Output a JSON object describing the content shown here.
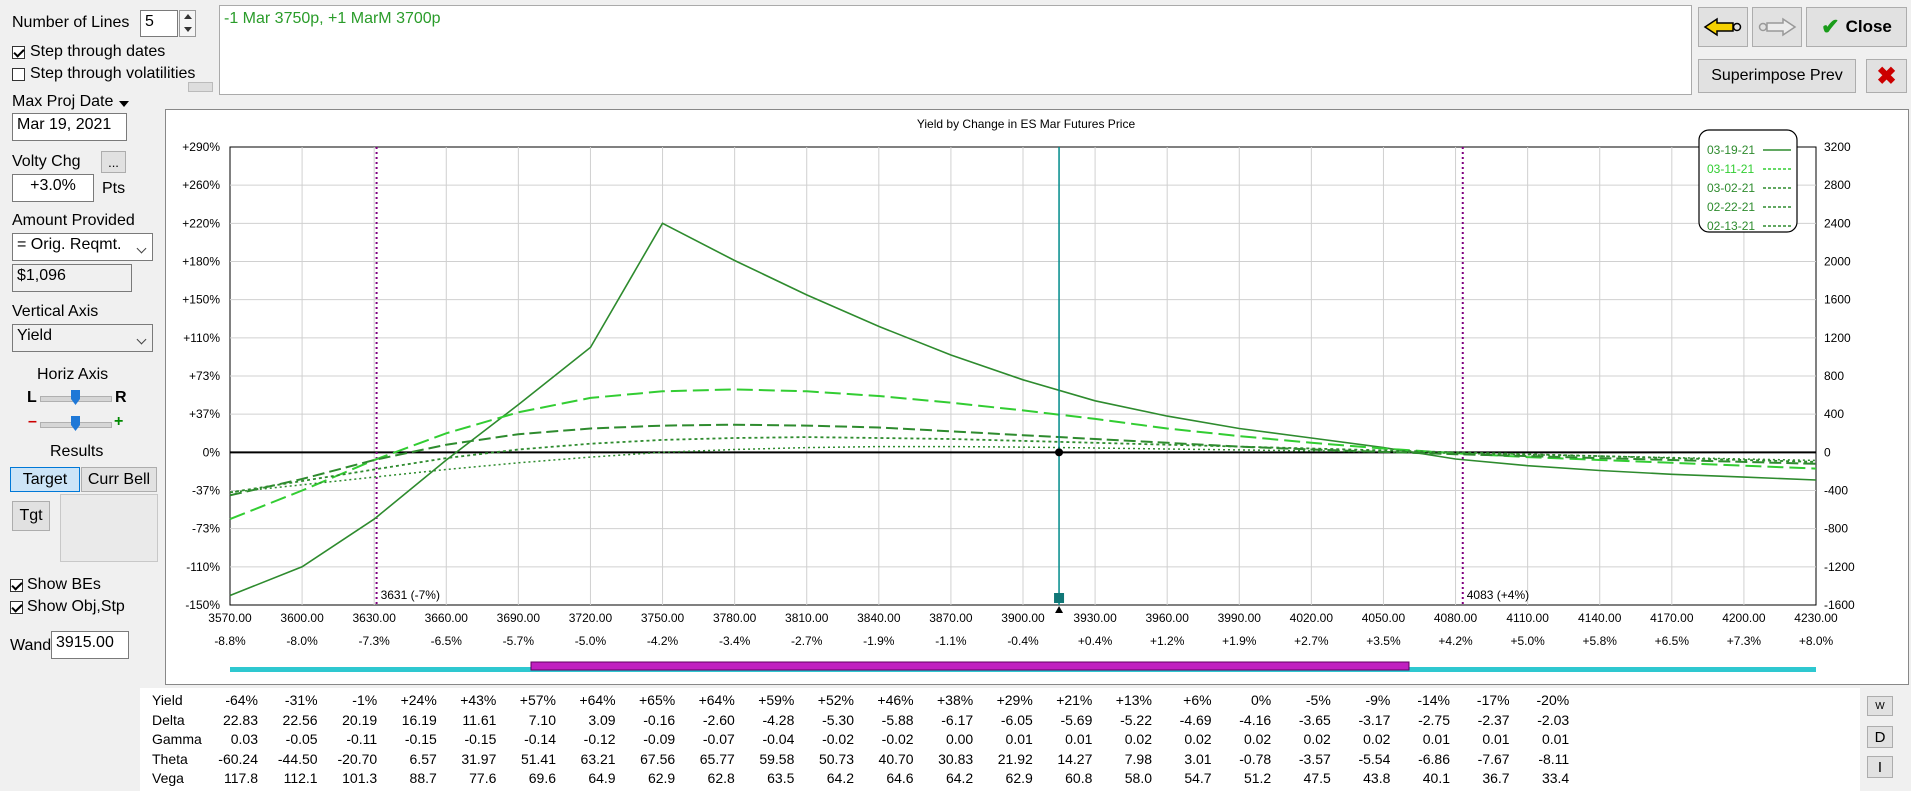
{
  "controls": {
    "num_lines_label": "Number of Lines",
    "num_lines_value": "5",
    "step_dates_label": "Step through dates",
    "step_dates_checked": true,
    "step_vols_label": "Step through volatilities",
    "step_vols_checked": false,
    "max_proj_label": "Max Proj Date",
    "max_proj_value": "Mar 19, 2021",
    "volty_label": "Volty Chg",
    "volty_btn": "...",
    "volty_value": "+3.0%",
    "volty_unit": "Pts",
    "amount_label": "Amount Provided",
    "amount_select": "= Orig. Reqmt.",
    "amount_value": "$1,096",
    "vaxis_label": "Vertical Axis",
    "vaxis_select": "Yield",
    "horiz_label": "Horiz Axis",
    "horiz_l": "L",
    "horiz_r": "R",
    "zoom_minus": "–",
    "zoom_plus": "+",
    "results_label": "Results",
    "target_btn": "Target",
    "currbell_btn": "Curr Bell",
    "tgt_btn": "Tgt",
    "show_bes_label": "Show BEs",
    "show_bes_checked": true,
    "show_obj_label": "Show Obj,Stp",
    "show_obj_checked": true,
    "wand_label": "Wand",
    "wand_value": "3915.00"
  },
  "position_text": "-1 Mar 3750p, +1 MarM 3700p",
  "buttons": {
    "close": "Close",
    "superimpose": "Superimpose Prev"
  },
  "colors": {
    "line_primary": "#2e8b2e",
    "line_light": "#32cd32",
    "be_line": "#800080",
    "wand_line": "#008b8b"
  },
  "chart_data": {
    "type": "line",
    "title": "Yield by Change in ES Mar Futures Price",
    "x_ticks": [
      "3570.00",
      "3600.00",
      "3630.00",
      "3660.00",
      "3690.00",
      "3720.00",
      "3750.00",
      "3780.00",
      "3810.00",
      "3840.00",
      "3870.00",
      "3900.00",
      "3930.00",
      "3960.00",
      "3990.00",
      "4020.00",
      "4050.00",
      "4080.00",
      "4110.00",
      "4140.00",
      "4170.00",
      "4200.00",
      "4230.00"
    ],
    "x_pct_ticks": [
      "-8.8%",
      "-8.0%",
      "-7.3%",
      "-6.5%",
      "-5.7%",
      "-5.0%",
      "-4.2%",
      "-3.4%",
      "-2.7%",
      "-1.9%",
      "-1.1%",
      "-0.4%",
      "+0.4%",
      "+1.2%",
      "+1.9%",
      "+2.7%",
      "+3.5%",
      "+4.2%",
      "+5.0%",
      "+5.8%",
      "+6.5%",
      "+7.3%",
      "+8.0%"
    ],
    "left_ticks": [
      "+290%",
      "+260%",
      "+220%",
      "+180%",
      "+150%",
      "+110%",
      "+73%",
      "+37%",
      "0%",
      "-37%",
      "-73%",
      "-110%",
      "-150%"
    ],
    "right_ticks": [
      "3200",
      "2800",
      "2400",
      "2000",
      "1600",
      "1200",
      "800",
      "400",
      "0",
      "-400",
      "-800",
      "-1200",
      "-1600"
    ],
    "xlim": [
      3570,
      4230
    ],
    "ylim": [
      -1600,
      3200
    ],
    "legend": [
      "03-19-21",
      "03-11-21",
      "03-02-21",
      "02-22-21",
      "02-13-21"
    ],
    "legend_position": "top-right",
    "breakevens": [
      {
        "x": 3631,
        "label": "3631 (-7%)"
      },
      {
        "x": 4083,
        "label": "4083 (+4%)"
      }
    ],
    "wand_x": 3915,
    "series": [
      {
        "name": "03-19-21",
        "style": "solid",
        "x": [
          3570,
          3600,
          3630,
          3660,
          3690,
          3720,
          3750,
          3780,
          3810,
          3840,
          3870,
          3900,
          3930,
          3960,
          3990,
          4020,
          4050,
          4080,
          4110,
          4140,
          4170,
          4200,
          4230
        ],
        "y": [
          -1500,
          -1200,
          -700,
          -80,
          500,
          1100,
          2400,
          2010,
          1650,
          1320,
          1020,
          760,
          540,
          380,
          250,
          150,
          50,
          -70,
          -140,
          -190,
          -230,
          -260,
          -290
        ]
      },
      {
        "name": "03-11-21",
        "style": "long-dash",
        "x": [
          3570,
          3600,
          3630,
          3660,
          3690,
          3720,
          3750,
          3780,
          3810,
          3840,
          3870,
          3900,
          3930,
          3960,
          3990,
          4020,
          4050,
          4080,
          4110,
          4140,
          4170,
          4200,
          4230
        ],
        "y": [
          -700,
          -400,
          -80,
          200,
          420,
          570,
          640,
          660,
          640,
          590,
          520,
          440,
          350,
          250,
          170,
          100,
          40,
          -10,
          -50,
          -80,
          -110,
          -140,
          -170
        ]
      },
      {
        "name": "03-02-21",
        "style": "dash",
        "x": [
          3570,
          3600,
          3630,
          3660,
          3690,
          3720,
          3750,
          3780,
          3810,
          3840,
          3870,
          3900,
          3930,
          3960,
          3990,
          4020,
          4050,
          4080,
          4110,
          4140,
          4170,
          4200,
          4230
        ],
        "y": [
          -450,
          -280,
          -80,
          80,
          190,
          250,
          280,
          290,
          280,
          260,
          220,
          180,
          140,
          100,
          60,
          30,
          5,
          -20,
          -40,
          -60,
          -80,
          -100,
          -120
        ]
      },
      {
        "name": "02-22-21",
        "style": "dot",
        "x": [
          3570,
          3600,
          3630,
          3660,
          3690,
          3720,
          3750,
          3780,
          3810,
          3840,
          3870,
          3900,
          3930,
          3960,
          3990,
          4020,
          4050,
          4080,
          4110,
          4140,
          4170,
          4200,
          4230
        ],
        "y": [
          -420,
          -300,
          -180,
          -60,
          30,
          90,
          130,
          150,
          160,
          150,
          140,
          120,
          100,
          80,
          60,
          40,
          20,
          0,
          -20,
          -40,
          -60,
          -80,
          -100
        ]
      },
      {
        "name": "02-13-21",
        "style": "dense-dot",
        "x": [
          3570,
          3600,
          3630,
          3660,
          3690,
          3720,
          3750,
          3780,
          3810,
          3840,
          3870,
          3900,
          3930,
          3960,
          3990,
          4020,
          4050,
          4080,
          4110,
          4140,
          4170,
          4200,
          4230
        ],
        "y": [
          -420,
          -340,
          -260,
          -180,
          -110,
          -50,
          0,
          30,
          50,
          60,
          60,
          55,
          45,
          35,
          25,
          15,
          5,
          -10,
          -25,
          -40,
          -55,
          -70,
          -85
        ]
      }
    ]
  },
  "table": {
    "rows": [
      {
        "name": "Yield",
        "values": [
          "-64%",
          "-31%",
          "-1%",
          "+24%",
          "+43%",
          "+57%",
          "+64%",
          "+65%",
          "+64%",
          "+59%",
          "+52%",
          "+46%",
          "+38%",
          "+29%",
          "+21%",
          "+13%",
          "+6%",
          "0%",
          "-5%",
          "-9%",
          "-14%",
          "-17%",
          "-20%"
        ]
      },
      {
        "name": "Delta",
        "values": [
          "22.83",
          "22.56",
          "20.19",
          "16.19",
          "11.61",
          "7.10",
          "3.09",
          "-0.16",
          "-2.60",
          "-4.28",
          "-5.30",
          "-5.88",
          "-6.17",
          "-6.05",
          "-5.69",
          "-5.22",
          "-4.69",
          "-4.16",
          "-3.65",
          "-3.17",
          "-2.75",
          "-2.37",
          "-2.03"
        ]
      },
      {
        "name": "Gamma",
        "values": [
          "0.03",
          "-0.05",
          "-0.11",
          "-0.15",
          "-0.15",
          "-0.14",
          "-0.12",
          "-0.09",
          "-0.07",
          "-0.04",
          "-0.02",
          "-0.02",
          "0.00",
          "0.01",
          "0.01",
          "0.02",
          "0.02",
          "0.02",
          "0.02",
          "0.02",
          "0.01",
          "0.01",
          "0.01"
        ]
      },
      {
        "name": "Theta",
        "values": [
          "-60.24",
          "-44.50",
          "-20.70",
          "6.57",
          "31.97",
          "51.41",
          "63.21",
          "67.56",
          "65.77",
          "59.58",
          "50.73",
          "40.70",
          "30.83",
          "21.92",
          "14.27",
          "7.98",
          "3.01",
          "-0.78",
          "-3.57",
          "-5.54",
          "-6.86",
          "-7.67",
          "-8.11"
        ]
      },
      {
        "name": "Vega",
        "values": [
          "117.8",
          "112.1",
          "101.3",
          "88.7",
          "77.6",
          "69.6",
          "64.9",
          "62.9",
          "62.8",
          "63.5",
          "64.2",
          "64.6",
          "64.2",
          "62.9",
          "60.8",
          "58.0",
          "54.7",
          "51.2",
          "47.5",
          "43.8",
          "40.1",
          "36.7",
          "33.4"
        ]
      }
    ],
    "side_btn_w": "W",
    "side_btn_d": "D",
    "side_btn_i": "I"
  }
}
